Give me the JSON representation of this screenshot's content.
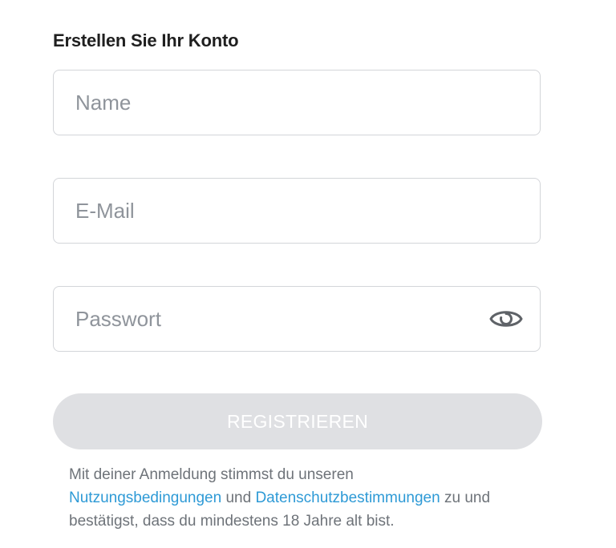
{
  "form": {
    "title": "Erstellen Sie Ihr Konto",
    "name_placeholder": "Name",
    "email_placeholder": "E-Mail",
    "password_placeholder": "Passwort",
    "password_toggle_icon": "eye-icon",
    "register_label": "REGISTRIEREN"
  },
  "legal": {
    "text_1": "Mit deiner Anmeldung stimmst du unseren",
    "terms_link": "Nutzungsbedingungen",
    "text_2": "und",
    "privacy_link": "Datenschutzbestimmungen",
    "text_3": "zu und bestätigst, dass du mindestens 18 Jahre alt bist."
  },
  "colors": {
    "link": "#2e9ad6",
    "button_disabled": "#dfe0e3",
    "border": "#d3d5d9",
    "placeholder": "#8f949b"
  }
}
